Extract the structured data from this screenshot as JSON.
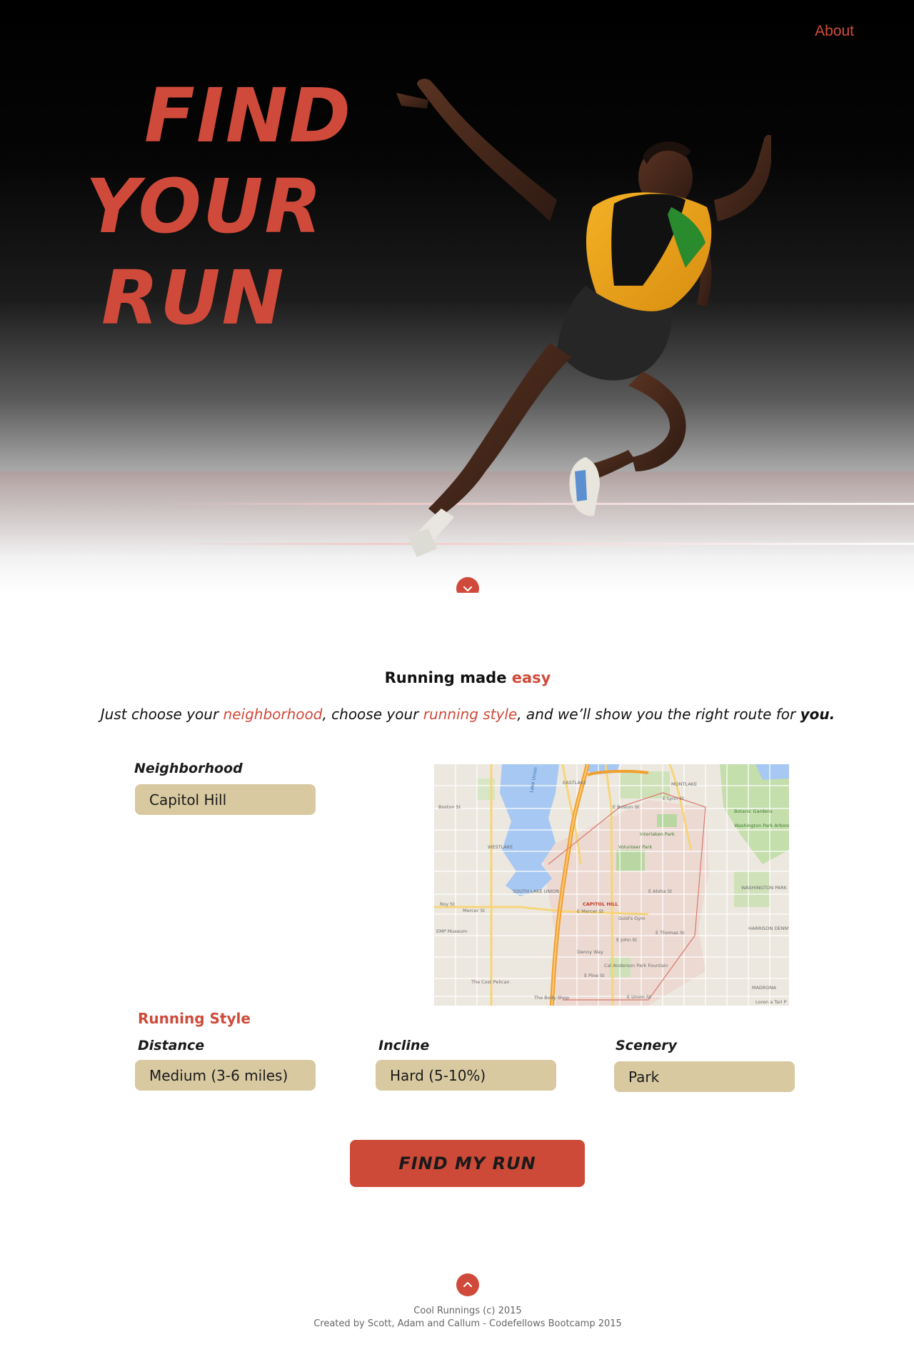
{
  "nav": {
    "about_label": "About"
  },
  "hero": {
    "title_line1": "FIND",
    "title_line2": "YOUR",
    "title_line3": "RUN"
  },
  "intro": {
    "heading_prefix": "Running made ",
    "heading_accent": "easy",
    "text_part1": "Just choose your ",
    "text_accent1": "neighborhood",
    "text_part2": ", choose your ",
    "text_accent2": "running style",
    "text_part3": ", and we’ll show you the right route for ",
    "text_emphasis": "you."
  },
  "form": {
    "neighborhood_label": "Neighborhood",
    "neighborhood_value": "Capitol Hill",
    "running_style_label": "Running Style",
    "distance_label": "Distance",
    "distance_value": "Medium (3-6 miles)",
    "incline_label": "Incline",
    "incline_value": "Hard (5-10%)",
    "scenery_label": "Scenery",
    "scenery_value": "Park",
    "submit_label": "FIND MY RUN"
  },
  "map": {
    "labels": {
      "eastlake": "EASTLAKE",
      "montlake": "MONTLAKE",
      "lake_union": "Lake Union",
      "westlake": "WESTLAKE",
      "capitol_hill": "CAPITOL HILL",
      "south_lake_union": "SOUTH LAKE UNION",
      "washington_park": "WASHINGTON PARK",
      "madrona": "MADRONA",
      "volunteer_park": "Volunteer Park",
      "interlaken_park": "Interlaken Park",
      "botanic_gardens": "Botanic Gardens",
      "arboretum": "Washington Park Arboretum Multi-Use",
      "golds_gym": "Gold's Gym",
      "cal_anderson": "Cal Anderson Park Fountain",
      "cost_pelican": "The Cost Pelican",
      "body_shop": "The Body Shop",
      "emp_museum": "EMP Museum",
      "mercer_st": "Mercer St",
      "denny_way": "Denny Way",
      "e_pine_st": "E Pine St",
      "e_union_st": "E Union St",
      "e_john_st": "E John St",
      "e_thomas_st": "E Thomas St",
      "e_aloha_st": "E Aloha St",
      "e_boston_st": "E Boston St",
      "e_lynn_st": "E Lynn St",
      "boston_st": "Boston St",
      "roy_st": "Roy St",
      "e_mercer_st": "E Mercer St",
      "harrison_denny": "HARRISON DENNY-BLAINE",
      "loren_miller": "Loren a Tari P"
    }
  },
  "footer": {
    "line1": "Cool Runnings (c) 2015",
    "line2": "Created by Scott, Adam and Callum - Codefellows Bootcamp 2015"
  },
  "colors": {
    "accent": "#cf4a3a",
    "select_bg": "#d8c9a1",
    "hero_bg": "#000000"
  },
  "icons": {
    "scroll_down": "chevron-down-icon",
    "scroll_up": "chevron-up-icon"
  }
}
